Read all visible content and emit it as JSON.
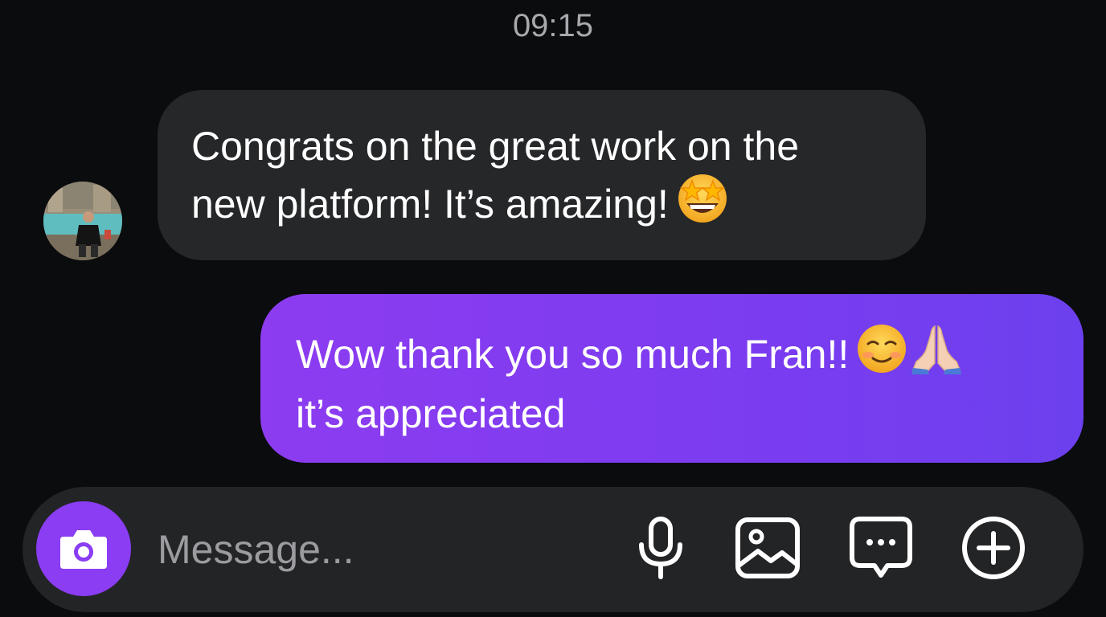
{
  "timestamp": "09:15",
  "incoming_message": {
    "line1": "Congrats on the great work on the",
    "line2": "new platform! It’s amazing!",
    "emoji": "star-struck-face-icon"
  },
  "outgoing_message": {
    "line1": "Wow thank you so much Fran!!",
    "line2": "it’s appreciated",
    "emojis": [
      "smiling-face-icon",
      "folded-hands-icon"
    ]
  },
  "composer": {
    "placeholder": "Message...",
    "actions": [
      "camera-icon",
      "microphone-icon",
      "gallery-icon",
      "chat-bubble-icon",
      "plus-icon"
    ]
  },
  "colors": {
    "background": "#0b0c0e",
    "incoming_bubble": "#262729",
    "outgoing_bubble": "#7f3cf0",
    "accent": "#8a3df2",
    "composer": "#232426"
  }
}
